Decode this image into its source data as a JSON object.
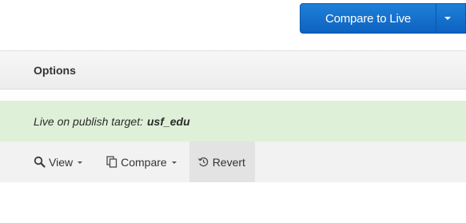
{
  "header": {
    "compare_to_live_label": "Compare to Live"
  },
  "options_bar": {
    "label": "Options"
  },
  "live_banner": {
    "prefix": "Live on publish target:",
    "target": "usf_edu",
    "background": "#dff0d8"
  },
  "toolbar": {
    "view_label": "View",
    "compare_label": "Compare",
    "revert_label": "Revert",
    "icons": {
      "view": "magnifier-icon",
      "compare": "copy-pages-icon",
      "revert": "undo-clock-icon"
    }
  },
  "colors": {
    "primary_button": "#1a75d0",
    "banner_green": "#dff0d8",
    "toolbar_bg": "#f2f2f2"
  }
}
